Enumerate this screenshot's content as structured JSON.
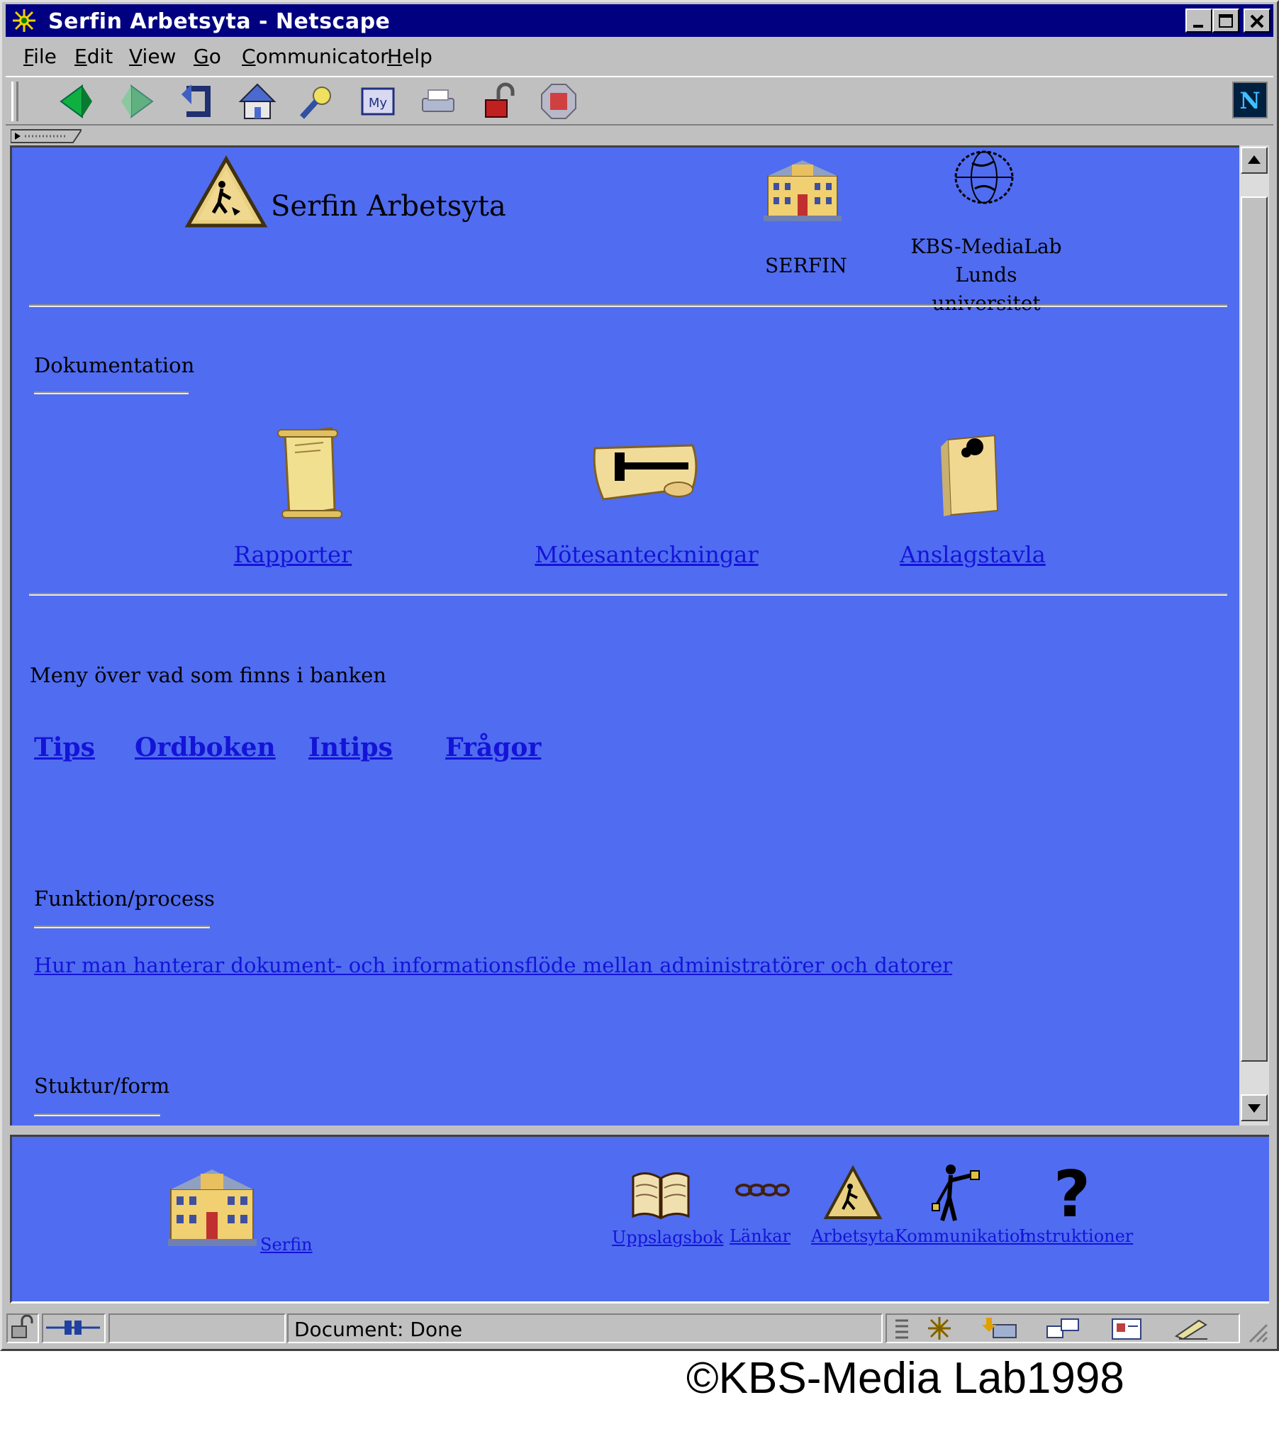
{
  "window": {
    "title": "Serfin Arbetsyta - Netscape",
    "menu": [
      {
        "label": "File",
        "mnemonic": "F",
        "rest": "ile"
      },
      {
        "label": "Edit",
        "mnemonic": "E",
        "rest": "dit"
      },
      {
        "label": "View",
        "mnemonic": "V",
        "rest": "iew"
      },
      {
        "label": "Go",
        "mnemonic": "G",
        "rest": "o"
      },
      {
        "label": "Communicator",
        "mnemonic": "C",
        "rest": "ommunicator"
      },
      {
        "label": "Help",
        "mnemonic": "H",
        "rest": "elp"
      }
    ],
    "toolbar_icons": [
      "back-icon",
      "forward-icon",
      "reload-icon",
      "home-icon",
      "search-icon",
      "my-netscape-icon",
      "print-icon",
      "security-icon",
      "stop-icon"
    ]
  },
  "page": {
    "site_title": "Serfin Arbetsyta",
    "serfin_label": "SERFIN",
    "kbs_line1": "KBS-MediaLab",
    "kbs_line2": "Lunds universitet",
    "dokumentation_heading": "Dokumentation",
    "doc_links": [
      "Rapporter",
      "Mötesanteckningar",
      "Anslagstavla"
    ],
    "meny_text": "Meny över vad som finns i banken",
    "meny_links": [
      "Tips",
      "Ordboken",
      "Intips",
      "Frågor"
    ],
    "funktion_heading": "Funktion/process",
    "funktion_link": "Hur man hanterar dokument- och informationsflöde mellan administratörer och datorer",
    "struktur_heading": "Stuktur/form"
  },
  "footer_nav": {
    "home_link": "Serfin",
    "links": [
      "Uppslagsbok",
      "Länkar",
      "Arbetsyta",
      "Kommunikation",
      "Instruktioner"
    ]
  },
  "status": {
    "text": "Document: Done"
  },
  "colors": {
    "page_background": "#506cf0",
    "link": "#1414d8",
    "titlebar": "#000080"
  },
  "copyright": "©KBS-Media Lab1998"
}
